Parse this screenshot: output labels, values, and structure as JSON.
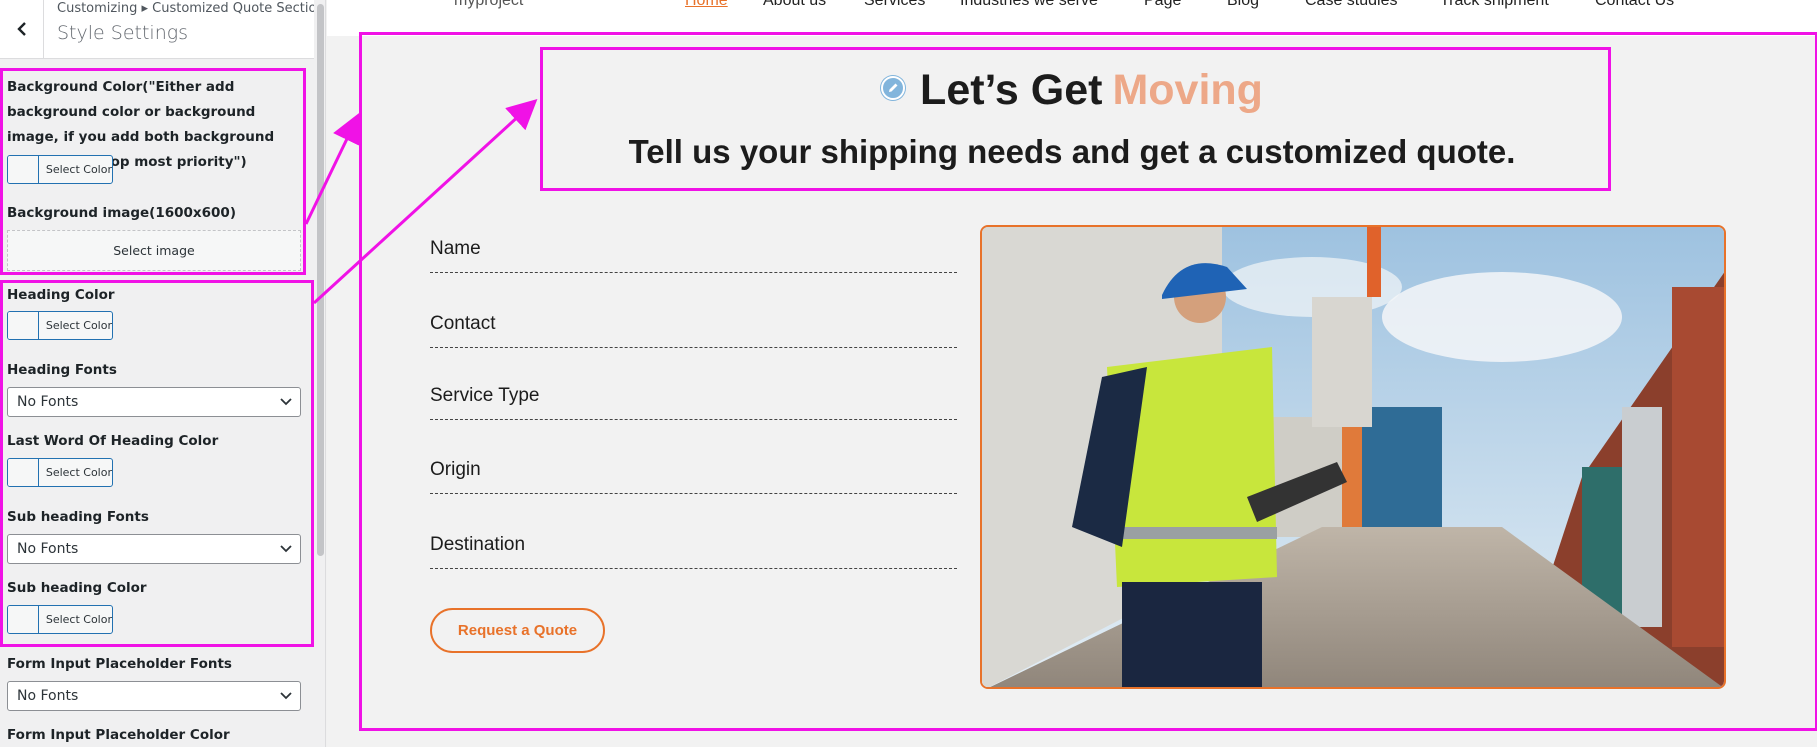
{
  "sidebar": {
    "breadcrumb": "Customizing ▸ Customized Quote Section",
    "title": "Style Settings",
    "bg_color_label": "Background Color(\"Either add background color or background image, if you add both background color will be top most priority\")",
    "bg_image_label": "Background image(1600x600)",
    "select_image": "Select image",
    "select_color": "Select Color",
    "heading_color_label": "Heading Color",
    "heading_fonts_label": "Heading Fonts",
    "heading_fonts_value": "No Fonts",
    "last_word_color_label": "Last Word Of Heading Color",
    "sub_heading_fonts_label": "Sub heading Fonts",
    "sub_heading_fonts_value": "No Fonts",
    "sub_heading_color_label": "Sub heading Color",
    "placeholder_fonts_label": "Form Input Placeholder Fonts",
    "placeholder_fonts_value": "No Fonts",
    "placeholder_color_label": "Form Input Placeholder Color"
  },
  "nav": {
    "brand": "myproject",
    "items": [
      "Home",
      "About us",
      "Services",
      "Industries we serve",
      "Page",
      "Blog",
      "Case studies",
      "Track shipment",
      "Contact Us"
    ]
  },
  "section": {
    "heading_main": "Let’s Get",
    "heading_last": "Moving",
    "subheading": "Tell us your shipping needs and get a customized quote.",
    "fields": [
      "Name",
      "Contact",
      "Service Type",
      "Origin",
      "Destination"
    ],
    "button": "Request a Quote"
  },
  "colors": {
    "accent": "#e8722a",
    "last_word": "#eda888",
    "annotation": "#f012e6",
    "admin_blue": "#2271b1"
  },
  "icons": {
    "back": "chevron-left-icon",
    "dropdown": "chevron-down-icon",
    "edit": "pencil-icon"
  }
}
